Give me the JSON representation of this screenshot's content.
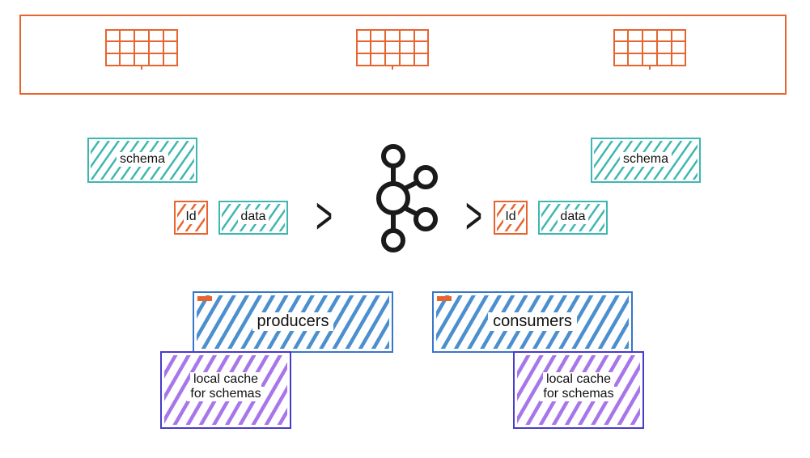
{
  "registry": {
    "schema_left": "schema",
    "schema_right": "schema",
    "id_left": "Id",
    "data_left": "data",
    "id_right": "Id",
    "data_right": "data"
  },
  "actors": {
    "producers_label": "producers",
    "consumers_label": "consumers",
    "cache_label_line1": "local cache",
    "cache_label_line2": "for schemas"
  },
  "glyphs": {
    "chevron": ">"
  },
  "colors": {
    "orange": "#e8642f",
    "teal": "#3fb7b0",
    "blue": "#3776c9",
    "darkblue": "#473bc9",
    "purple": "#9b6be0",
    "ink": "#1a1a1a"
  }
}
